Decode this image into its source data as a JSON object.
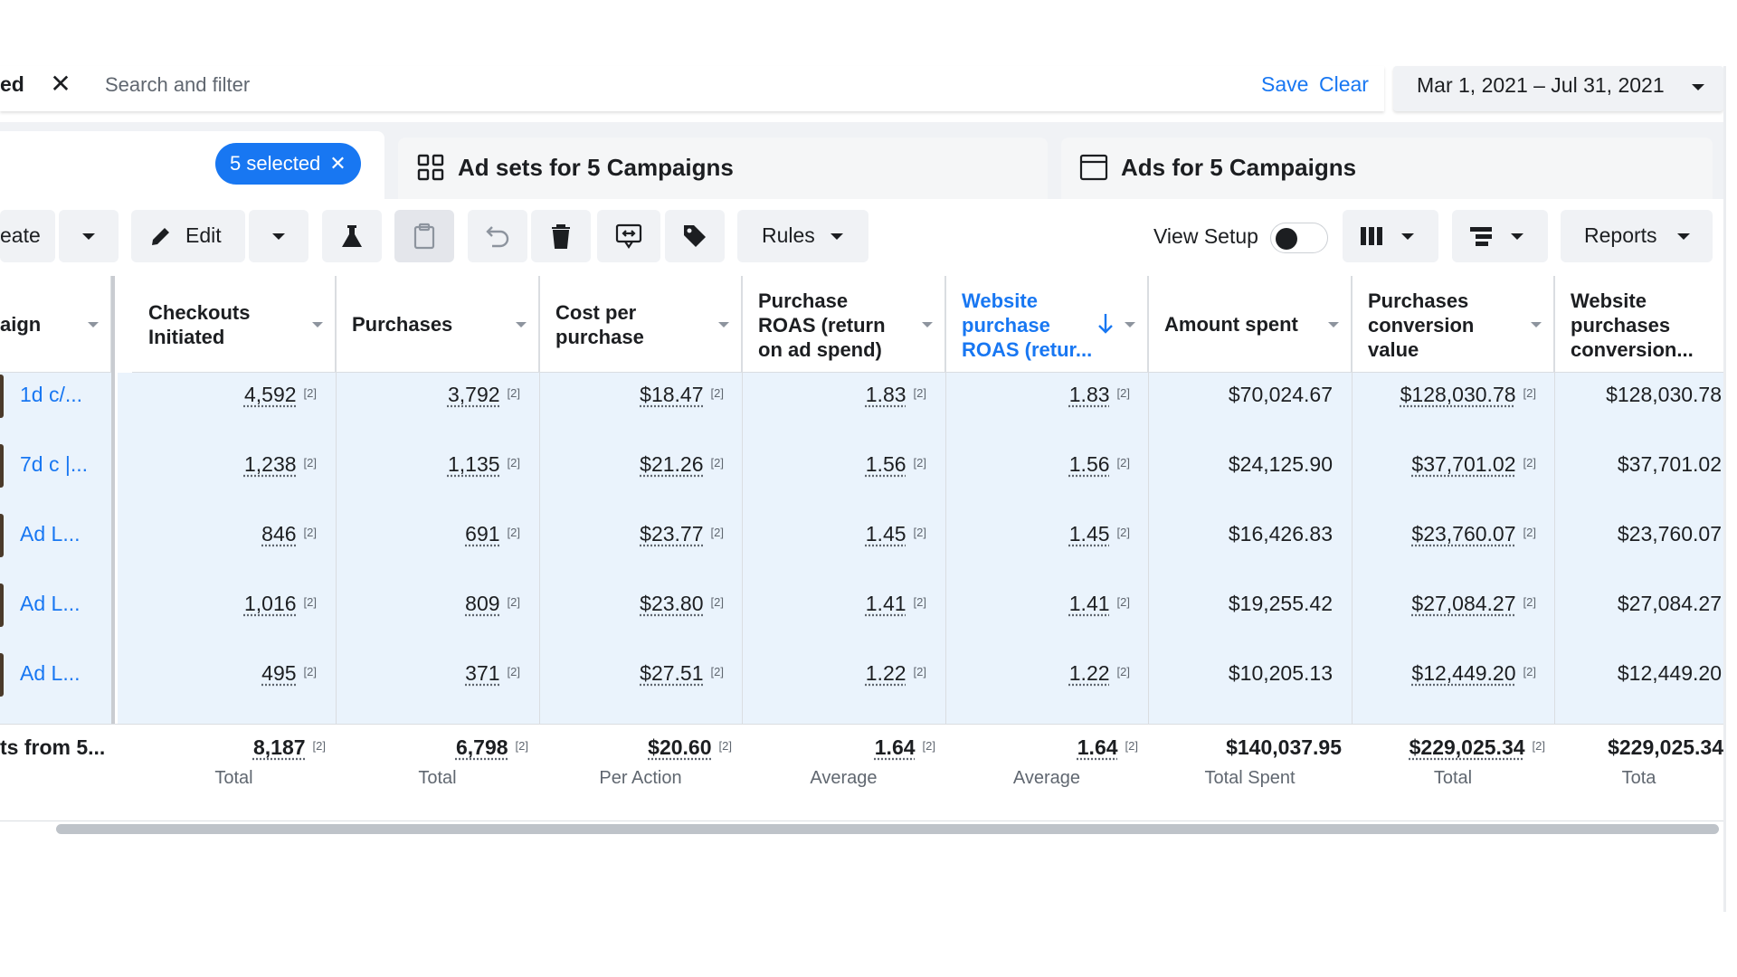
{
  "search": {
    "chip_tail": "ed",
    "placeholder": "Search and filter",
    "save": "Save",
    "clear": "Clear",
    "date_range": "Mar 1, 2021 – Jul 31, 2021"
  },
  "tabs": {
    "selected_pill": "5 selected",
    "adsets": "Ad sets for 5 Campaigns",
    "ads": "Ads for 5 Campaigns"
  },
  "toolbar": {
    "create_tail": "eate",
    "edit": "Edit",
    "rules": "Rules",
    "view_setup": "View Setup",
    "reports": "Reports"
  },
  "columns": {
    "name": "aign",
    "checkouts": "Checkouts Initiated",
    "purchases": "Purchases",
    "cost": "Cost per purchase",
    "roas": "Purchase ROAS (return on ad spend)",
    "web_roas": "Website purchase ROAS (retur...",
    "spent": "Amount spent",
    "conv_value": "Purchases conversion value",
    "web_conv": "Website purchases conversion..."
  },
  "rows": [
    {
      "name": "1d c/...",
      "checkouts": "4,592",
      "purchases": "3,792",
      "cost": "$18.47",
      "roas": "1.83",
      "web_roas": "1.83",
      "spent": "$70,024.67",
      "conv_value": "$128,030.78",
      "web_conv": "$128,030.78"
    },
    {
      "name": "7d c |...",
      "checkouts": "1,238",
      "purchases": "1,135",
      "cost": "$21.26",
      "roas": "1.56",
      "web_roas": "1.56",
      "spent": "$24,125.90",
      "conv_value": "$37,701.02",
      "web_conv": "$37,701.02"
    },
    {
      "name": "Ad L...",
      "checkouts": "846",
      "purchases": "691",
      "cost": "$23.77",
      "roas": "1.45",
      "web_roas": "1.45",
      "spent": "$16,426.83",
      "conv_value": "$23,760.07",
      "web_conv": "$23,760.07"
    },
    {
      "name": "Ad L...",
      "checkouts": "1,016",
      "purchases": "809",
      "cost": "$23.80",
      "roas": "1.41",
      "web_roas": "1.41",
      "spent": "$19,255.42",
      "conv_value": "$27,084.27",
      "web_conv": "$27,084.27"
    },
    {
      "name": "Ad L...",
      "checkouts": "495",
      "purchases": "371",
      "cost": "$27.51",
      "roas": "1.22",
      "web_roas": "1.22",
      "spent": "$10,205.13",
      "conv_value": "$12,449.20",
      "web_conv": "$12,449.20"
    }
  ],
  "footnote": "[2]",
  "totals": {
    "label": "ts from 5...",
    "checkouts": "8,187",
    "checkouts_sub": "Total",
    "purchases": "6,798",
    "purchases_sub": "Total",
    "cost": "$20.60",
    "cost_sub": "Per Action",
    "roas": "1.64",
    "roas_sub": "Average",
    "web_roas": "1.64",
    "web_roas_sub": "Average",
    "spent": "$140,037.95",
    "spent_sub": "Total Spent",
    "conv_value": "$229,025.34",
    "conv_value_sub": "Total",
    "web_conv": "$229,025.34",
    "web_conv_sub": "Tota"
  },
  "colors": {
    "accent": "#1877f2",
    "selected_row": "#eaf3fc",
    "toolbar_btn": "#f0f2f5"
  },
  "icons": [
    "close-icon",
    "caret-down-icon",
    "adsets-grid-icon",
    "ad-card-icon",
    "pencil-icon",
    "flask-icon",
    "clipboard-icon",
    "undo-icon",
    "trash-icon",
    "ab-test-icon",
    "tag-icon",
    "columns-icon",
    "breakdown-icon",
    "sort-down-arrow-icon"
  ]
}
